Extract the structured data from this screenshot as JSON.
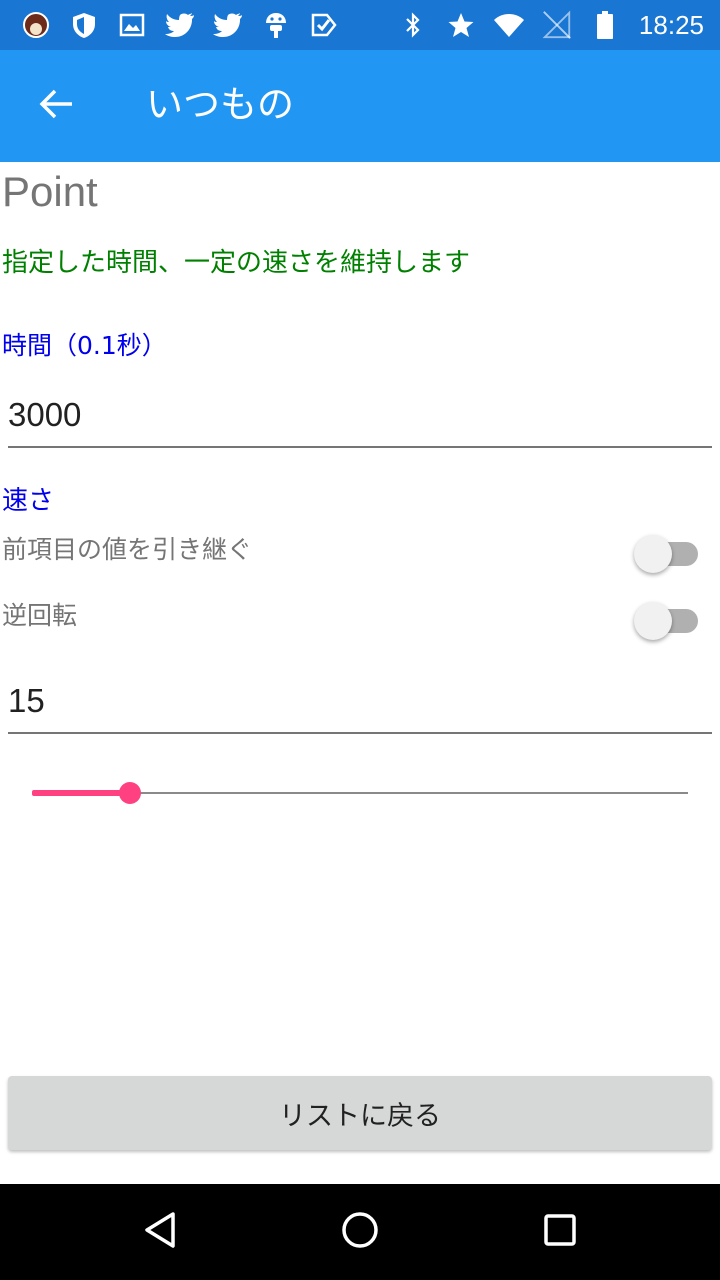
{
  "status_bar": {
    "time": "18:25",
    "left_icons": [
      "avatar-icon",
      "shield-icon",
      "image-icon",
      "twitter-icon",
      "twitter-icon",
      "android-icon",
      "app-check-icon"
    ],
    "right_icons": [
      "bluetooth-icon",
      "star-icon",
      "wifi-icon",
      "no-signal-icon",
      "battery-icon"
    ]
  },
  "app_bar": {
    "title": "いつもの"
  },
  "content": {
    "point_title": "Point",
    "description": "指定した時間、一定の速さを維持します",
    "time_label": "時間（0.1秒）",
    "time_value": "3000",
    "speed_label": "速さ",
    "inherit_label": "前項目の値を引き継ぐ",
    "inherit_on": false,
    "reverse_label": "逆回転",
    "reverse_on": false,
    "speed_value": "15",
    "speed_fraction": 0.15
  },
  "back_to_list_label": "リストに戻る",
  "colors": {
    "status_bar": "#1976D2",
    "app_bar": "#2196F3",
    "description": "#008000",
    "label_blue": "#0000EE",
    "accent": "#FF4081"
  }
}
